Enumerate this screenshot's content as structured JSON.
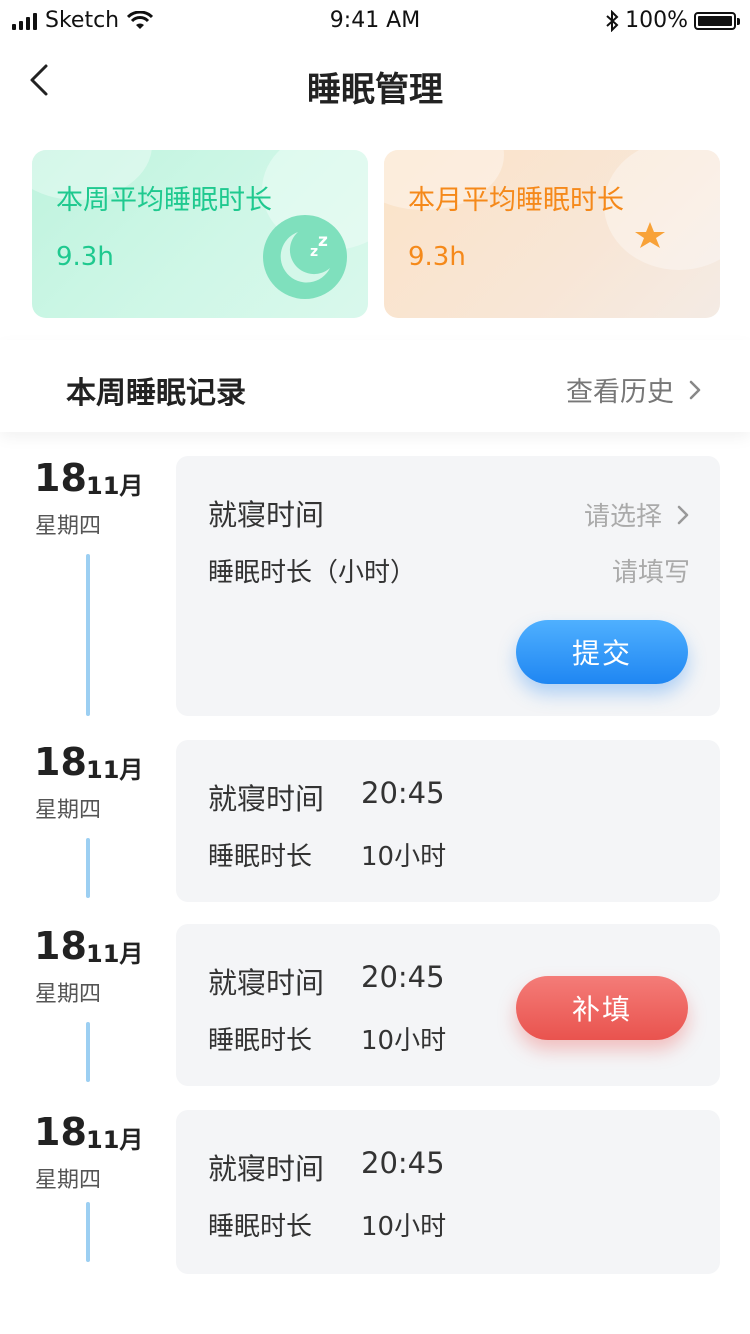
{
  "status_bar": {
    "carrier": "Sketch",
    "time": "9:41 AM",
    "battery": "100%"
  },
  "nav": {
    "title": "睡眠管理"
  },
  "summary": {
    "week": {
      "label": "本周平均睡眠时长",
      "value": "9.3h",
      "icon": "moon-zzz-icon",
      "color": "#1fc98f"
    },
    "month": {
      "label": "本月平均睡眠时长",
      "value": "9.3h",
      "icon": "moon-star-icon",
      "color": "#f5891a"
    }
  },
  "section": {
    "title": "本周睡眠记录",
    "more_label": "查看历史"
  },
  "records": [
    {
      "day": "18",
      "month": "11月",
      "weekday": "星期四",
      "bedtime_label": "就寝时间",
      "bedtime_placeholder": "请选择",
      "duration_label": "睡眠时长（小时）",
      "duration_placeholder": "请填写",
      "button": "提交"
    },
    {
      "day": "18",
      "month": "11月",
      "weekday": "星期四",
      "bedtime_label": "就寝时间",
      "bedtime": "20:45",
      "duration_label": "睡眠时长",
      "duration": "10小时"
    },
    {
      "day": "18",
      "month": "11月",
      "weekday": "星期四",
      "bedtime_label": "就寝时间",
      "bedtime": "20:45",
      "duration_label": "睡眠时长",
      "duration": "10小时",
      "button": "补填"
    },
    {
      "day": "18",
      "month": "11月",
      "weekday": "星期四",
      "bedtime_label": "就寝时间",
      "bedtime": "20:45",
      "duration_label": "睡眠时长",
      "duration": "10小时"
    }
  ],
  "colors": {
    "primary_blue": "#1f86f2",
    "alert_red": "#e9534e",
    "timeline": "#9ccff2"
  }
}
